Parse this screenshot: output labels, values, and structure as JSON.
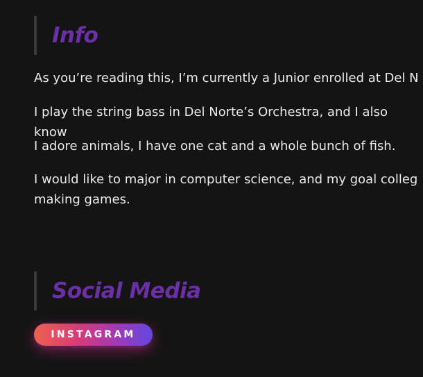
{
  "info": {
    "heading": "Info",
    "paragraphs": [
      "As you’re reading this, I’m currently a Junior enrolled at Del N",
      "I play the string bass in Del Norte’s Orchestra, and I also know",
      "I adore animals, I have one cat and a whole bunch of fish.",
      "I would like to major in computer science, and my goal colleg",
      "making games."
    ]
  },
  "social": {
    "heading": "Social Media",
    "instagram_label": "INSTAGRAM"
  },
  "colors": {
    "background": "#141414",
    "heading": "#6b2fa6",
    "text": "#eaeaea",
    "accent_bar": "#3a3a3a"
  }
}
